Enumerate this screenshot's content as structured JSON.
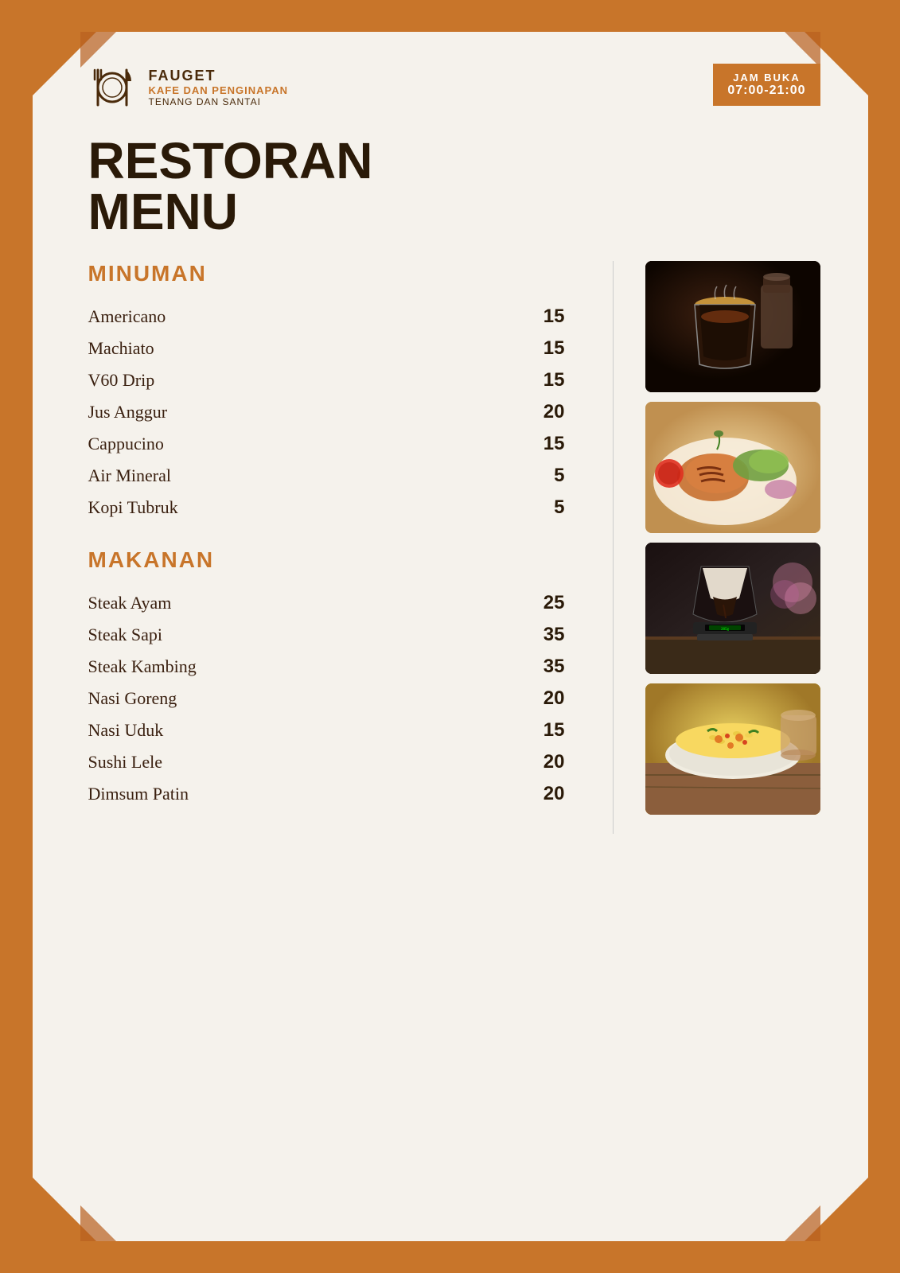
{
  "brand": {
    "name": "FAUGET",
    "sub1": "KAFE DAN PENGINAPAN",
    "sub2": "TENANG DAN SANTAI"
  },
  "hours": {
    "label": "JAM BUKA",
    "time": "07:00-21:00"
  },
  "page_title": "RESTORAN MENU",
  "sections": {
    "drinks": {
      "heading": "MINUMAN",
      "items": [
        {
          "name": "Americano",
          "price": "15"
        },
        {
          "name": "Machiato",
          "price": "15"
        },
        {
          "name": "V60 Drip",
          "price": "15"
        },
        {
          "name": "Jus Anggur",
          "price": "20"
        },
        {
          "name": "Cappucino",
          "price": "15"
        },
        {
          "name": "Air Mineral",
          "price": "5"
        },
        {
          "name": "Kopi Tubruk",
          "price": "5"
        }
      ]
    },
    "food": {
      "heading": "MAKANAN",
      "items": [
        {
          "name": "Steak Ayam",
          "price": "25"
        },
        {
          "name": "Steak Sapi",
          "price": "35"
        },
        {
          "name": "Steak Kambing",
          "price": "35"
        },
        {
          "name": "Nasi Goreng",
          "price": "20"
        },
        {
          "name": "Nasi Uduk",
          "price": "15"
        },
        {
          "name": "Sushi Lele",
          "price": "20"
        },
        {
          "name": "Dimsum Patin",
          "price": "20"
        }
      ]
    }
  },
  "images": [
    {
      "alt": "coffee",
      "type": "coffee"
    },
    {
      "alt": "grilled chicken",
      "type": "food"
    },
    {
      "alt": "drip coffee",
      "type": "drip"
    },
    {
      "alt": "fried rice",
      "type": "rice"
    }
  ],
  "colors": {
    "brown": "#c8752a",
    "dark": "#2a1a08",
    "accent": "#4a2a0a"
  }
}
